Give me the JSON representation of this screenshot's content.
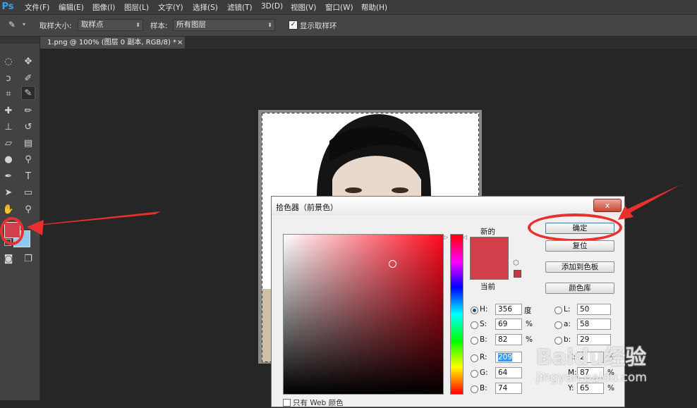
{
  "app": {
    "logo": "Ps",
    "menu": [
      "文件(F)",
      "编辑(E)",
      "图像(I)",
      "图层(L)",
      "文字(Y)",
      "选择(S)",
      "滤镜(T)",
      "3D(D)",
      "视图(V)",
      "窗口(W)",
      "帮助(H)"
    ]
  },
  "options": {
    "sample_size_label": "取样大小:",
    "sample_size_value": "取样点",
    "sample_label": "样本:",
    "sample_value": "所有图层",
    "show_ring_label": "显示取样环"
  },
  "document": {
    "tab_title": "1.png @ 100% (图层 0 副本, RGB/8) *",
    "tab_close": "×"
  },
  "colors": {
    "foreground": "#d1404a",
    "background": "#8fc9f0",
    "accent_annotation": "#e8302e"
  },
  "picker": {
    "title": "拾色器（前景色）",
    "close": "x",
    "new_label": "新的",
    "current_label": "当前",
    "ok_label": "确定",
    "reset_label": "复位",
    "add_swatch_label": "添加到色板",
    "library_label": "颜色库",
    "h_label": "H:",
    "h_value": "356",
    "h_unit": "度",
    "s_label": "S:",
    "s_value": "69",
    "s_unit": "%",
    "b_label": "B:",
    "b_value": "82",
    "b_unit": "%",
    "r_label": "R:",
    "r_value": "209",
    "g_label": "G:",
    "g_value": "64",
    "bb_label": "B:",
    "bb_value": "74",
    "l_label": "L:",
    "l_value": "50",
    "a_label": "a:",
    "a_value": "58",
    "lab_b_label": "b:",
    "lab_b_value": "29",
    "c_label": "C:",
    "c_value": "2",
    "c_unit": "%",
    "m_label": "M:",
    "m_value": "87",
    "m_unit": "%",
    "y_label": "Y:",
    "y_value": "65",
    "y_unit": "%",
    "only_web_label": "只有 Web 颜色"
  },
  "watermark": {
    "text": "Baidu经验",
    "url": "jingyan.baidu.com"
  }
}
